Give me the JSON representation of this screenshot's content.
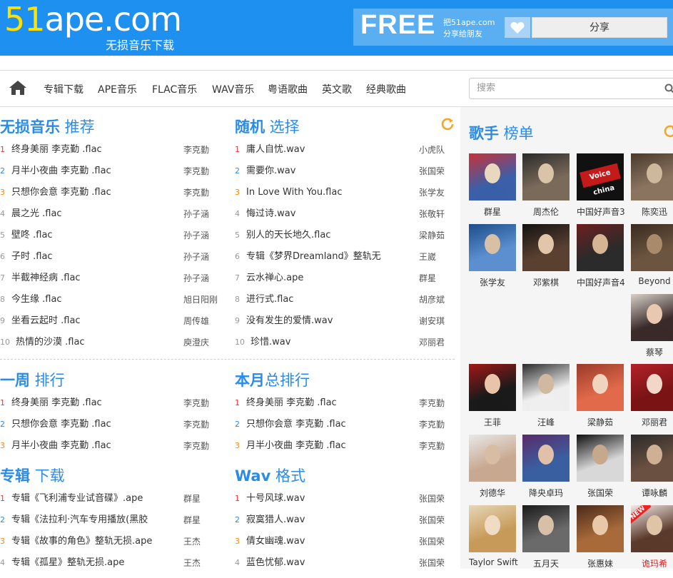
{
  "header": {
    "logo_num": "51",
    "logo_rest": "ape.com",
    "subtitle": "无损音乐下载",
    "free": "FREE",
    "free_line1": "把51ape.com",
    "free_line2": "分享给朋友",
    "share_label": "分享"
  },
  "nav": {
    "items": [
      "专辑下载",
      "APE音乐",
      "FLAC音乐",
      "WAV音乐",
      "粤语歌曲",
      "英文歌",
      "经典歌曲"
    ],
    "search_placeholder": "搜索"
  },
  "sections": {
    "recommend": {
      "t1": "无损音乐",
      "t2": " 推荐",
      "songs": [
        {
          "rank": "1",
          "title": "终身美丽 李克勤 .flac",
          "artist": "李克勤"
        },
        {
          "rank": "2",
          "title": "月半小夜曲 李克勤 .flac",
          "artist": "李克勤"
        },
        {
          "rank": "3",
          "title": "只想你会意 李克勤 .flac",
          "artist": "李克勤"
        },
        {
          "rank": "4",
          "title": "晨之光 .flac",
          "artist": "孙子涵"
        },
        {
          "rank": "5",
          "title": "壁咚 .flac",
          "artist": "孙子涵"
        },
        {
          "rank": "6",
          "title": "子时 .flac",
          "artist": "孙子涵"
        },
        {
          "rank": "7",
          "title": "半截神经病 .flac",
          "artist": "孙子涵"
        },
        {
          "rank": "8",
          "title": "今生缘 .flac",
          "artist": "旭日阳刚"
        },
        {
          "rank": "9",
          "title": "坐看云起时 .flac",
          "artist": "周传雄"
        },
        {
          "rank": "10",
          "title": "热情的沙漠 .flac",
          "artist": "庾澄庆"
        }
      ]
    },
    "random": {
      "t1": "随机",
      "t2": " 选择",
      "songs": [
        {
          "rank": "1",
          "title": "庸人自忧.wav",
          "artist": "小虎队"
        },
        {
          "rank": "2",
          "title": "需要你.wav",
          "artist": "张国荣"
        },
        {
          "rank": "3",
          "title": "In Love With You.flac",
          "artist": "张学友"
        },
        {
          "rank": "4",
          "title": "悔过诗.wav",
          "artist": "张敬轩"
        },
        {
          "rank": "5",
          "title": "别人的天长地久.flac",
          "artist": "梁静茹"
        },
        {
          "rank": "6",
          "title": "专辑《梦界Dreamland》整轨无",
          "artist": "王崴"
        },
        {
          "rank": "7",
          "title": "云水禅心.ape",
          "artist": "群星"
        },
        {
          "rank": "8",
          "title": "进行式.flac",
          "artist": "胡彦斌"
        },
        {
          "rank": "9",
          "title": "没有发生的爱情.wav",
          "artist": "谢安琪"
        },
        {
          "rank": "10",
          "title": "珍惜.wav",
          "artist": "邓丽君"
        }
      ]
    },
    "week": {
      "t1": "一周",
      "t2": " 排行",
      "songs": [
        {
          "rank": "1",
          "title": "终身美丽 李克勤 .flac",
          "artist": "李克勤"
        },
        {
          "rank": "2",
          "title": "只想你会意 李克勤 .flac",
          "artist": "李克勤"
        },
        {
          "rank": "3",
          "title": "月半小夜曲 李克勤 .flac",
          "artist": "李克勤"
        }
      ]
    },
    "month": {
      "t1": "本月",
      "t2": "总排行",
      "songs": [
        {
          "rank": "1",
          "title": "终身美丽 李克勤 .flac",
          "artist": "李克勤"
        },
        {
          "rank": "2",
          "title": "只想你会意 李克勤 .flac",
          "artist": "李克勤"
        },
        {
          "rank": "3",
          "title": "月半小夜曲 李克勤 .flac",
          "artist": "李克勤"
        }
      ]
    },
    "album": {
      "t1": "专辑",
      "t2": " 下载",
      "songs": [
        {
          "rank": "1",
          "title": "专辑《飞利浦专业试音碟》.ape",
          "artist": "群星"
        },
        {
          "rank": "2",
          "title": "专辑《法拉利·汽车专用播放(黑胶",
          "artist": "群星"
        },
        {
          "rank": "3",
          "title": "专辑《故事的角色》整轨无损.ape",
          "artist": "王杰"
        },
        {
          "rank": "4",
          "title": "专辑《孤星》整轨无损.ape",
          "artist": "王杰"
        }
      ]
    },
    "wav": {
      "t1": "Wav",
      "t2": " 格式",
      "songs": [
        {
          "rank": "1",
          "title": "十号风球.wav",
          "artist": "张国荣"
        },
        {
          "rank": "2",
          "title": "寂寞猎人.wav",
          "artist": "张国荣"
        },
        {
          "rank": "3",
          "title": "倩女幽魂.wav",
          "artist": "张国荣"
        },
        {
          "rank": "4",
          "title": "蓝色忧郁.wav",
          "artist": "张国荣"
        }
      ]
    }
  },
  "sidebar": {
    "t1": "歌手",
    "t2": " 榜单",
    "singers": [
      "群星",
      "周杰伦",
      "中国好声音3",
      "陈奕迅",
      "张学友",
      "邓紫棋",
      "中国好声音4",
      "Beyond",
      "蔡琴",
      "王菲",
      "汪峰",
      "梁静茹",
      "邓丽君",
      "刘德华",
      "降央卓玛",
      "张国荣",
      "谭咏麟",
      "Taylor Swift",
      "五月天",
      "张惠妹",
      "诡玛希"
    ],
    "new_tag": "NEW",
    "voice_logo": "Voice china",
    "colors": {
      "accent": "#2a8ce6",
      "header": "#1e90f0",
      "refresh": "#f5a623",
      "rank1": "#e33333",
      "rank3": "#ff8800"
    }
  }
}
